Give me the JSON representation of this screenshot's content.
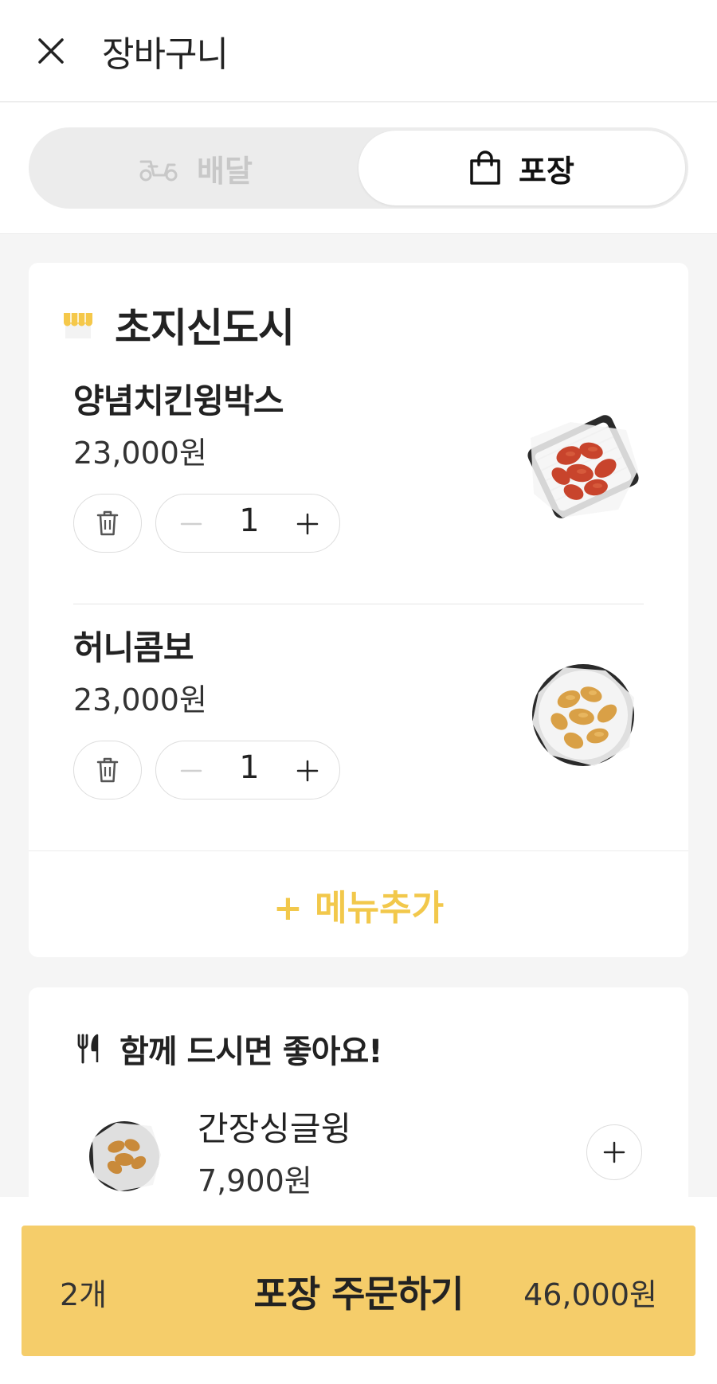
{
  "header": {
    "title": "장바구니",
    "close_icon": "close-icon"
  },
  "toggle": {
    "delivery_label": "배달",
    "takeout_label": "포장",
    "selected": "포장"
  },
  "store": {
    "name": "초지신도시",
    "items": [
      {
        "name": "양념치킨윙박스",
        "price": "23,000원",
        "qty": "1",
        "image": "spicy-wings-image"
      },
      {
        "name": "허니콤보",
        "price": "23,000원",
        "qty": "1",
        "image": "honey-combo-image"
      }
    ],
    "add_menu_label": "+ 메뉴추가"
  },
  "recommend": {
    "title": "함께 드시면 좋아요!",
    "items": [
      {
        "name": "간장싱글윙",
        "price": "7,900원",
        "image": "soy-wing-image"
      }
    ]
  },
  "order": {
    "count": "2개",
    "label": "포장 주문하기",
    "total": "46,000원"
  },
  "colors": {
    "accent": "#f5cd6a",
    "add_menu": "#f2c84b"
  }
}
